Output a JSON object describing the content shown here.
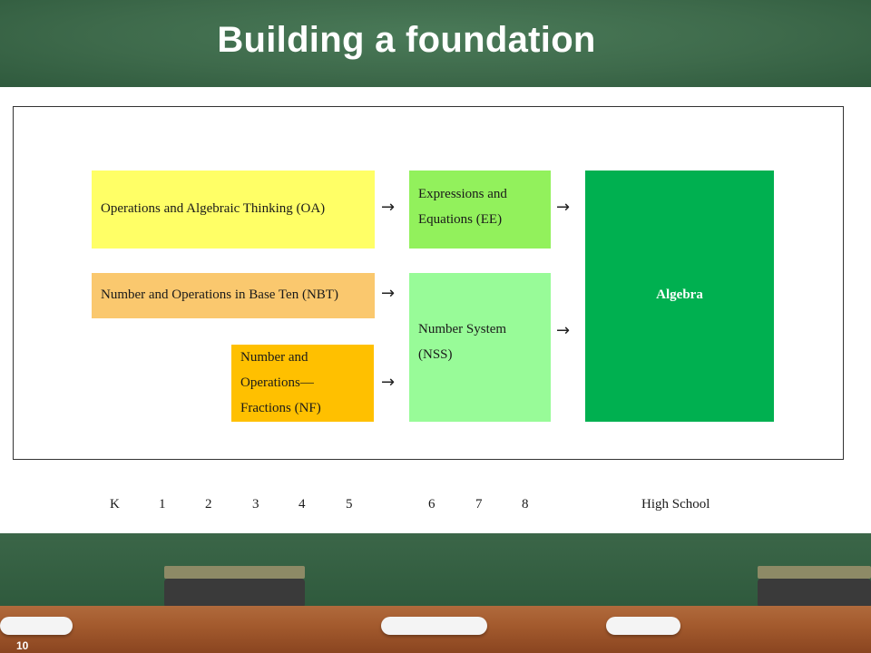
{
  "slide": {
    "title": "Building a foundation",
    "page_number": "10"
  },
  "diagram": {
    "boxes": {
      "oa": {
        "lines": [
          "Operations and Algebraic Thinking (OA)"
        ],
        "color": "#ffff66"
      },
      "nbt": {
        "lines": [
          "Number and Operations in Base Ten (NBT)"
        ],
        "color": "#fac86e"
      },
      "nf": {
        "lines": [
          "Number and",
          "Operations—",
          "Fractions (NF)"
        ],
        "color": "#ffc000"
      },
      "ee": {
        "lines": [
          "Expressions and",
          "Equations (EE)"
        ],
        "color": "#92f15c"
      },
      "nss": {
        "lines": [
          "Number System",
          "(NSS)"
        ],
        "color": "#98fb98"
      },
      "alg": {
        "lines": [
          "Algebra"
        ],
        "color": "#00b050"
      }
    },
    "arrow_glyph": "→",
    "grades": [
      "K",
      "1",
      "2",
      "3",
      "4",
      "5",
      "6",
      "7",
      "8",
      "High School"
    ]
  }
}
